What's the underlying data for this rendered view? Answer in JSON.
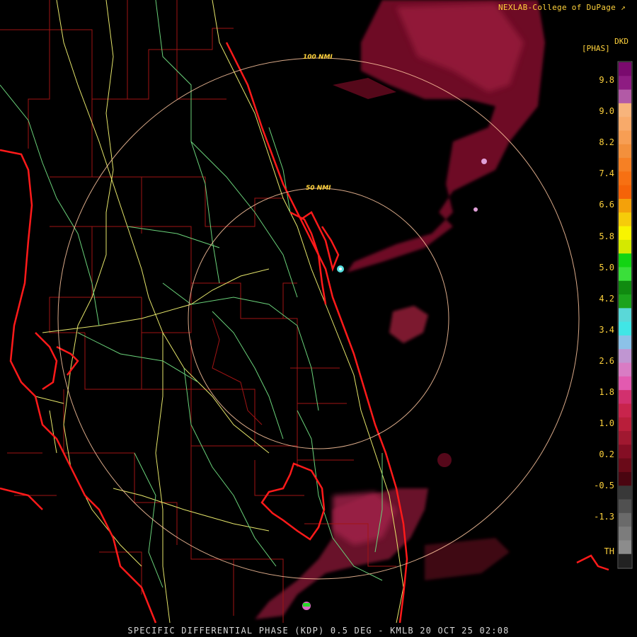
{
  "header": {
    "credit": "NEXLAB-College of DuPage",
    "credit_icon": "diagonal-arrow-icon"
  },
  "legend": {
    "title_left": "[PHAS]",
    "title_right": "DKD",
    "threshold_label": "TH",
    "ticks": [
      "9.8",
      "9.0",
      "8.2",
      "7.4",
      "6.6",
      "5.8",
      "5.0",
      "4.2",
      "3.4",
      "2.6",
      "1.8",
      "1.0",
      "0.2",
      "-0.5",
      "-1.3"
    ],
    "colors": [
      "#7a0a6e",
      "#8e1c82",
      "#b25aa6",
      "#f7b47c",
      "#f8aa6a",
      "#f79e54",
      "#f3903c",
      "#f68024",
      "#f77012",
      "#f56308",
      "#f4a10a",
      "#f6cc0a",
      "#f8f400",
      "#d4e900",
      "#13d413",
      "#3adf3a",
      "#108a10",
      "#1ca31c",
      "#5ad8d8",
      "#41e6e6",
      "#8cc2e8",
      "#c096d2",
      "#d97cc4",
      "#e35ab0",
      "#d2306e",
      "#c8244c",
      "#b91e3a",
      "#a01830",
      "#840e24",
      "#6a0a18",
      "#4a0510",
      "#383838",
      "#505050",
      "#6a6a6a",
      "#7c7c7c",
      "#8c8c8c",
      "#222222"
    ]
  },
  "rings": {
    "inner_label": "50 NMI",
    "outer_label": "100 NMI"
  },
  "footer": {
    "caption": "SPECIFIC DIFFERENTIAL PHASE (KDP) 0.5 DEG - KMLB 20 OCT 25 02:08"
  }
}
